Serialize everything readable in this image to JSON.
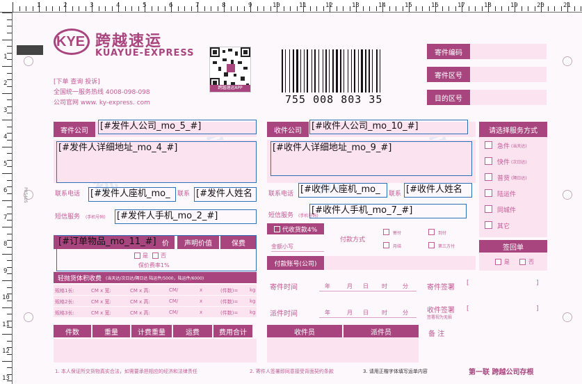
{
  "ruler": {
    "top_numbers": [
      "1",
      "2",
      "3",
      "4",
      "5",
      "6",
      "7",
      "8",
      "9",
      "10",
      "11",
      "12",
      "13",
      "14",
      "15",
      "16",
      "17",
      "18",
      "19",
      "20",
      "21"
    ],
    "left_numbers": [
      "1",
      "2",
      "3",
      "4",
      "5",
      "6",
      "7",
      "8",
      "9",
      "10",
      "11",
      "12",
      "13"
    ]
  },
  "brand": {
    "logo_text": "KYE",
    "name_cn": "跨越速运",
    "name_en": "KUAYUE-EXPRESS",
    "links": "[下单   查询   投诉]",
    "hotline": "全国统一服务热线  4008-098-098",
    "website": "公司官网 www. ky-express. com",
    "app_caption": "跨越速运APP"
  },
  "barcode": {
    "number": "755   008   803   35"
  },
  "right_header": [
    "寄件编码",
    "寄件区号",
    "目的区号"
  ],
  "sender": {
    "header": "寄件公司",
    "company_field": "[#发件人公司_mo_5_#]",
    "address_field": "[#发件人详细地址_mo_4_#]",
    "phone_label": "联系电话",
    "landline_field": "[#发件人座机_mo_",
    "contact_label": "联系",
    "name_field": "[#发件人姓名",
    "sms_label": "短信服务",
    "sms_sub": "(手机号码)",
    "mobile_field": "[#发件人手机_mo_2_#]"
  },
  "receiver": {
    "header": "收件公司",
    "company_field": "[#收件人公司_mo_10_#]",
    "address_field": "[#收件人详细地址_mo_9_#]",
    "phone_label": "联系电话",
    "landline_field": "[#收件人座机_mo_",
    "contact_label": "联系",
    "name_field": "[#收件人姓名",
    "sms_label": "短信服务",
    "sms_sub": "(手机号码)",
    "mobile_field": "[#收件人手机_mo_7_#]"
  },
  "goods": {
    "field": "[#订单物品_mo_11_#]",
    "col_value": "价",
    "col_declared": "声明价值",
    "col_insured": "保费",
    "no_label": "是",
    "yes_label": "否",
    "insure_rate": "保价费率1%"
  },
  "volume": {
    "header": "轻抛货体积收费",
    "header_note": "(当天达/次日达/隔日达 陆运件/5000，陆运件/6000)",
    "rows": [
      [
        "规格1长:",
        "CM x 宽:",
        "CM x 高:",
        "CM/",
        "x",
        "(件数)=",
        "kg"
      ],
      [
        "规格2长:",
        "CM x 宽:",
        "CM x 高:",
        "CM/",
        "x",
        "(件数)=",
        "kg"
      ],
      [
        "规格3长:",
        "CM x 宽:",
        "CM x 高:",
        "CM/",
        "x",
        "(件数)=",
        "kg"
      ]
    ]
  },
  "cost_headers": [
    "件数",
    "重量",
    "计费重量",
    "运费",
    "费用合计"
  ],
  "payment": {
    "cod": "代收货款4%",
    "amount_label": "金额小写",
    "method_label": "付款方式",
    "options": [
      "寄付",
      "到付",
      "月结",
      "第三方付"
    ],
    "account_label": "付款账号(公司)"
  },
  "service": {
    "header": "请选择服务方式",
    "options": [
      "急件",
      "快件",
      "普货",
      "陆运件",
      "同城件",
      "其它"
    ],
    "options_sub": [
      "(当天达)",
      "(次日达)",
      "(隔日达)",
      "",
      "",
      ""
    ],
    "receipt_header": "签回单",
    "receipt_yes": "是",
    "receipt_no": "否"
  },
  "times": {
    "send_time": "寄件时间",
    "deliver_time": "派件时间",
    "units": [
      "年",
      "月",
      "日",
      "时",
      "分"
    ],
    "send_sign": "寄件签署",
    "recv_sign": "收件签署",
    "recv_sign_sub": "签署视为无损",
    "bracket_l": "[",
    "bracket_r": "]"
  },
  "staff": {
    "collector": "收件员",
    "dispatcher": "派件员",
    "remark": "备 注"
  },
  "footer": {
    "note1": "1. 本人保证所交货物真实合法，如需要承担相应的经济和法律责任",
    "note2": "2. 寄件人签署即同意接受背面契约条款",
    "note3": "3. 请用正楷字体填写运单内容",
    "copy_label": "第一联  跨越公司存根"
  },
  "side_code": "P05405",
  "watermarks": [
    "统一代寄专号",
    "统一代寄专号"
  ],
  "colors": {
    "brand": "#a8457f",
    "pink_light": "#fbe3f0",
    "field_border": "#2c6fb7"
  }
}
